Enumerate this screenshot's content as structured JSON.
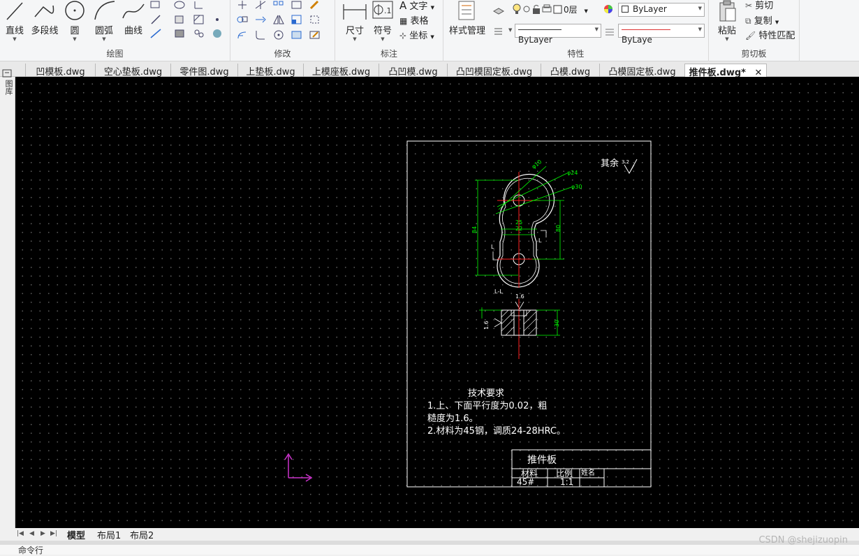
{
  "ribbon": {
    "draw": {
      "title": "绘图",
      "line": "直线",
      "polyline": "多段线",
      "circle": "圆",
      "arc": "圆弧",
      "curve": "曲线"
    },
    "modify": {
      "title": "修改"
    },
    "annotate": {
      "title": "标注",
      "dimension": "尺寸",
      "symbol": "符号",
      "text": "文字",
      "table": "表格",
      "coordinate": "坐标"
    },
    "properties": {
      "title": "特性",
      "style_manager": "样式管理",
      "layer": "0层",
      "color": "ByLayer",
      "linetype": "ByLayer",
      "lineweight": "ByLaye"
    },
    "clipboard": {
      "title": "剪切板",
      "paste": "粘贴",
      "cut": "剪切",
      "copy": "复制",
      "match": "特性匹配"
    }
  },
  "tabs": [
    "凹模板.dwg",
    "空心垫板.dwg",
    "零件图.dwg",
    "上垫板.dwg",
    "上模座板.dwg",
    "凸凹模.dwg",
    "凸凹模固定板.dwg",
    "凸模.dwg",
    "凸模固定板.dwg",
    "推件板.dwg*"
  ],
  "active_tab": "推件板.dwg*",
  "left_strip_label": "图库",
  "drawing": {
    "roughness_other": "其余",
    "roughness_other_value": "3.2",
    "dims": {
      "d1": "φ10",
      "d2": "φ24",
      "d3": "φ30",
      "w1": "25",
      "w2": "22",
      "h1": "84",
      "h2": "80",
      "section_mark": "L",
      "section_title": "L-L",
      "surface_top": "1.6",
      "surface_side": "1.6",
      "thickness": "30"
    },
    "tech_title": "技术要求",
    "tech_line1": "1.上、下面平行度为0.02，粗",
    "tech_line2": "糙度为1.6。",
    "tech_line3": "2.材料为45钢，调质24-28HRC。",
    "title_block": {
      "part_name": "推件板",
      "material_label": "材料",
      "scale_label": "比例",
      "name_label": "姓名",
      "material": "45#",
      "scale": "1:1"
    }
  },
  "layout_tabs": [
    "模型",
    "布局1",
    "布局2"
  ],
  "command_line": "命令行",
  "watermark": "CSDN @shejizuopin",
  "colors": {
    "canvas": "#000000",
    "dimension": "#00ff00",
    "centerline": "#ff0000",
    "geometry": "#ffffff",
    "ucs": "#cc33cc"
  }
}
